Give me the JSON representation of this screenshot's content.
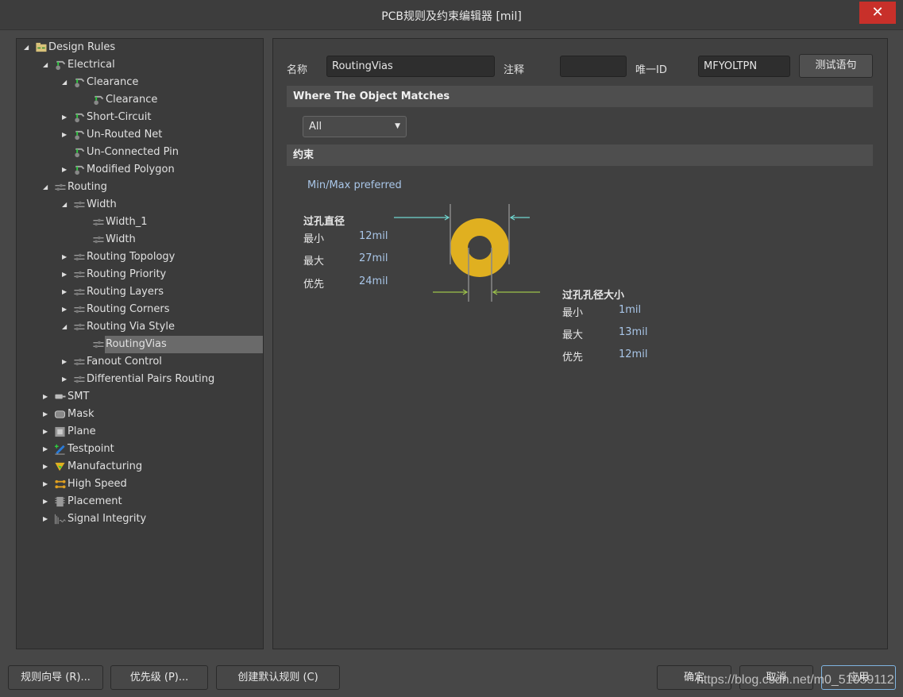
{
  "window": {
    "title": "PCB规则及约束编辑器 [mil]",
    "close_glyph": "✕"
  },
  "tree": [
    {
      "label": "Design Rules",
      "level": 0,
      "arrow": "expanded",
      "icon": "folder-rules-icon"
    },
    {
      "label": "Electrical",
      "level": 1,
      "arrow": "expanded",
      "icon": "electrical-rule-icon"
    },
    {
      "label": "Clearance",
      "level": 2,
      "arrow": "expanded",
      "icon": "electrical-rule-icon"
    },
    {
      "label": "Clearance",
      "level": 3,
      "arrow": "none",
      "icon": "electrical-rule-icon"
    },
    {
      "label": "Short-Circuit",
      "level": 2,
      "arrow": "collapsed",
      "icon": "electrical-rule-icon"
    },
    {
      "label": "Un-Routed Net",
      "level": 2,
      "arrow": "collapsed",
      "icon": "electrical-rule-icon"
    },
    {
      "label": "Un-Connected Pin",
      "level": 2,
      "arrow": "none",
      "icon": "electrical-rule-icon"
    },
    {
      "label": "Modified Polygon",
      "level": 2,
      "arrow": "collapsed",
      "icon": "electrical-rule-icon"
    },
    {
      "label": "Routing",
      "level": 1,
      "arrow": "expanded",
      "icon": "routing-rule-icon"
    },
    {
      "label": "Width",
      "level": 2,
      "arrow": "expanded",
      "icon": "routing-rule-icon"
    },
    {
      "label": "Width_1",
      "level": 3,
      "arrow": "none",
      "icon": "routing-rule-icon"
    },
    {
      "label": "Width",
      "level": 3,
      "arrow": "none",
      "icon": "routing-rule-icon"
    },
    {
      "label": "Routing Topology",
      "level": 2,
      "arrow": "collapsed",
      "icon": "routing-rule-icon"
    },
    {
      "label": "Routing Priority",
      "level": 2,
      "arrow": "collapsed",
      "icon": "routing-rule-icon"
    },
    {
      "label": "Routing Layers",
      "level": 2,
      "arrow": "collapsed",
      "icon": "routing-rule-icon"
    },
    {
      "label": "Routing Corners",
      "level": 2,
      "arrow": "collapsed",
      "icon": "routing-rule-icon"
    },
    {
      "label": "Routing Via Style",
      "level": 2,
      "arrow": "expanded",
      "icon": "routing-rule-icon"
    },
    {
      "label": "RoutingVias",
      "level": 3,
      "arrow": "none",
      "icon": "routing-rule-icon",
      "selected": true
    },
    {
      "label": "Fanout Control",
      "level": 2,
      "arrow": "collapsed",
      "icon": "routing-rule-icon"
    },
    {
      "label": "Differential Pairs Routing",
      "level": 2,
      "arrow": "collapsed",
      "icon": "routing-rule-icon"
    },
    {
      "label": "SMT",
      "level": 1,
      "arrow": "collapsed",
      "icon": "smt-icon"
    },
    {
      "label": "Mask",
      "level": 1,
      "arrow": "collapsed",
      "icon": "mask-icon"
    },
    {
      "label": "Plane",
      "level": 1,
      "arrow": "collapsed",
      "icon": "plane-icon"
    },
    {
      "label": "Testpoint",
      "level": 1,
      "arrow": "collapsed",
      "icon": "testpoint-icon"
    },
    {
      "label": "Manufacturing",
      "level": 1,
      "arrow": "collapsed",
      "icon": "manufacturing-icon"
    },
    {
      "label": "High Speed",
      "level": 1,
      "arrow": "collapsed",
      "icon": "high-speed-icon"
    },
    {
      "label": "Placement",
      "level": 1,
      "arrow": "collapsed",
      "icon": "placement-icon"
    },
    {
      "label": "Signal Integrity",
      "level": 1,
      "arrow": "collapsed",
      "icon": "signal-integrity-icon"
    }
  ],
  "form": {
    "name_label": "名称",
    "name_value": "RoutingVias",
    "comment_label": "注释",
    "comment_value": "",
    "id_label": "唯一ID",
    "id_value": "MFYOLTPN",
    "test_button": "测试语句"
  },
  "match": {
    "header": "Where The Object Matches",
    "selected": "All"
  },
  "constraints": {
    "header": "约束",
    "mode": "Min/Max preferred",
    "via_diameter": {
      "title": "过孔直径",
      "rows": [
        {
          "label": "最小",
          "value": "12mil"
        },
        {
          "label": "最大",
          "value": "27mil"
        },
        {
          "label": "优先",
          "value": "24mil"
        }
      ]
    },
    "hole_size": {
      "title": "过孔孔径大小",
      "rows": [
        {
          "label": "最小",
          "value": "1mil"
        },
        {
          "label": "最大",
          "value": "13mil"
        },
        {
          "label": "优先",
          "value": "12mil"
        }
      ]
    },
    "colors": {
      "pad": "#e0b020",
      "diameter_arrow": "#6fd6d0",
      "hole_arrow": "#9cc24a"
    }
  },
  "footer": {
    "wizard": "规则向导 (R)...",
    "priority": "优先级 (P)...",
    "create_default": "创建默认规则 (C)",
    "ok": "确定",
    "cancel": "取消",
    "apply": "应用"
  },
  "watermark": "https://blog.csdn.net/m0_51059112"
}
